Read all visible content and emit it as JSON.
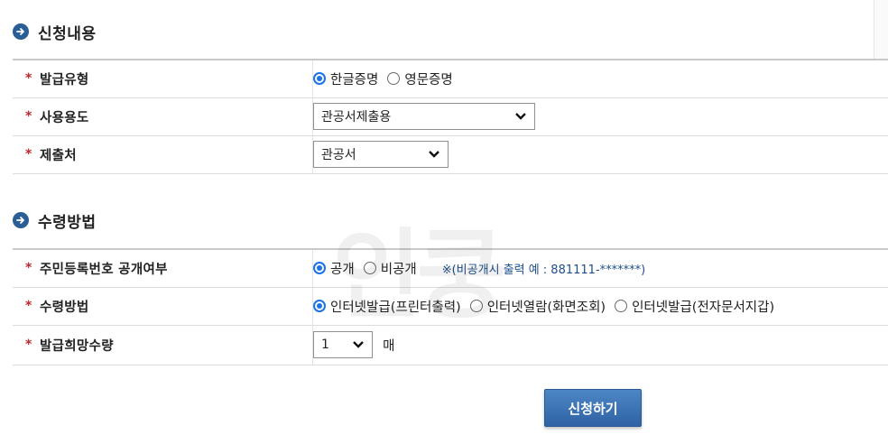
{
  "colors": {
    "accent": "#2a5e94",
    "required": "#c0262d",
    "radio_on": "#1a73e8",
    "note": "#1f4f8a"
  },
  "icons": {
    "section": "arrow-right-circle-icon",
    "select": "chevron-down-icon"
  },
  "application": {
    "title": "신청내용",
    "rows": [
      {
        "label": "발급유형",
        "options": [
          "한글증명",
          "영문증명"
        ],
        "selected": 0
      },
      {
        "label": "사용용도",
        "select_value": "관공서제출용"
      },
      {
        "label": "제출처",
        "select_value": "관공서"
      }
    ]
  },
  "receipt": {
    "title": "수령방법",
    "rows": [
      {
        "label": "주민등록번호 공개여부",
        "options": [
          "공개",
          "비공개"
        ],
        "selected": 0,
        "note": "※(비공개시 출력 예 : 881111-*******)"
      },
      {
        "label": "수령방법",
        "options": [
          "인터넷발급(프린터출력)",
          "인터넷열람(화면조회)",
          "인터넷발급(전자문서지갑)"
        ],
        "selected": 0
      },
      {
        "label": "발급희망수량",
        "select_value": "1",
        "unit": "매"
      }
    ]
  },
  "submit_label": "신청하기",
  "watermark": "인쿵"
}
